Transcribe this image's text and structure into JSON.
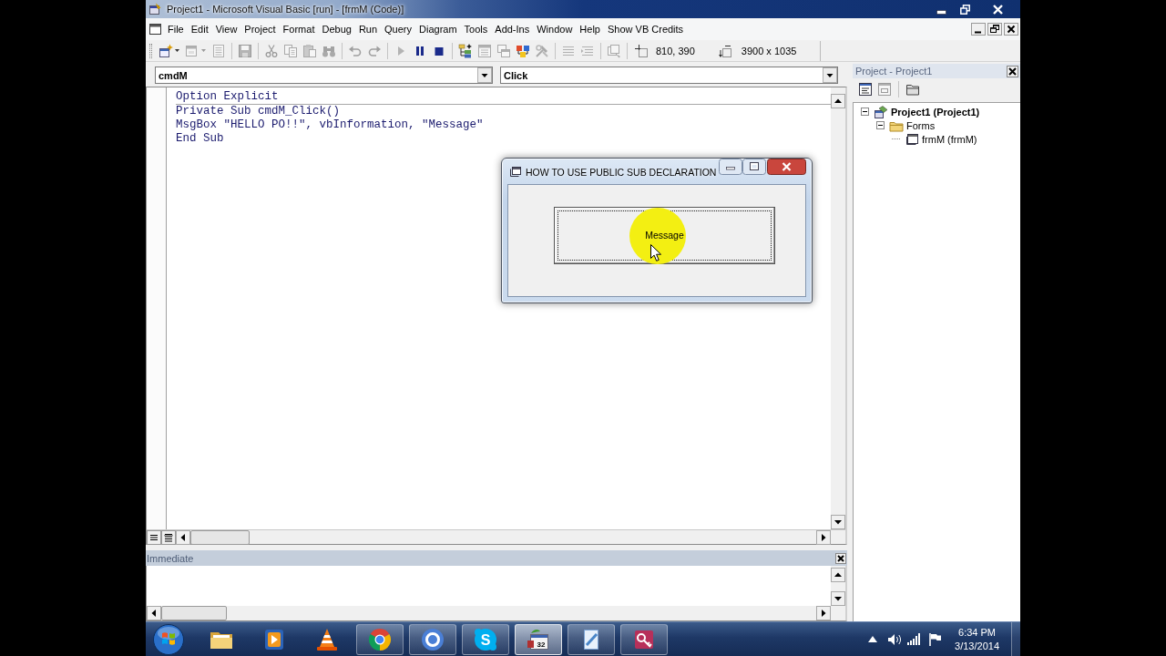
{
  "window": {
    "title": "Project1 - Microsoft Visual Basic [run] - [frmM (Code)]"
  },
  "menu_bar": {
    "items": [
      "File",
      "Edit",
      "View",
      "Project",
      "Format",
      "Debug",
      "Run",
      "Query",
      "Diagram",
      "Tools",
      "Add-Ins",
      "Window",
      "Help",
      "Show VB Credits"
    ]
  },
  "toolbar": {
    "groups": [
      [
        {
          "kind": "add-project",
          "disabled": false,
          "dropdown": true
        },
        {
          "kind": "add-form",
          "disabled": true,
          "dropdown": true
        },
        {
          "kind": "menu-editor",
          "disabled": true,
          "dropdown": false
        }
      ],
      [
        {
          "kind": "save",
          "disabled": true,
          "dropdown": false
        }
      ],
      [
        {
          "kind": "cut",
          "disabled": true,
          "dropdown": false
        },
        {
          "kind": "copy",
          "disabled": true,
          "dropdown": false
        },
        {
          "kind": "paste",
          "disabled": true,
          "dropdown": false
        },
        {
          "kind": "find",
          "disabled": true,
          "dropdown": false
        }
      ],
      [
        {
          "kind": "undo",
          "disabled": true,
          "dropdown": false
        },
        {
          "kind": "redo",
          "disabled": true,
          "dropdown": false
        }
      ],
      [
        {
          "kind": "start",
          "disabled": true,
          "dropdown": false
        },
        {
          "kind": "break",
          "disabled": false,
          "dropdown": false
        },
        {
          "kind": "end",
          "disabled": false,
          "dropdown": false
        }
      ],
      [
        {
          "kind": "project-explorer",
          "disabled": false,
          "dropdown": false
        },
        {
          "kind": "properties",
          "disabled": true,
          "dropdown": false
        },
        {
          "kind": "form-layout",
          "disabled": true,
          "dropdown": false
        },
        {
          "kind": "object-browser",
          "disabled": false,
          "dropdown": false
        },
        {
          "kind": "toolbox",
          "disabled": true,
          "dropdown": false
        }
      ],
      [
        {
          "kind": "comment",
          "disabled": true,
          "dropdown": false
        },
        {
          "kind": "uncomment",
          "disabled": true,
          "dropdown": false
        }
      ],
      [
        {
          "kind": "form-editor",
          "disabled": true,
          "dropdown": false
        }
      ]
    ],
    "position": "810, 390",
    "size": "3900 x 1035"
  },
  "code_window": {
    "object": "cmdM",
    "procedure": "Click",
    "sections": [
      {
        "lines": [
          "Option Explicit"
        ]
      },
      {
        "lines": [
          "Private Sub cmdM_Click()",
          "MsgBox \"HELLO PO!!\", vbInformation, \"Message\"",
          "End Sub"
        ]
      }
    ]
  },
  "immediate": {
    "title": "Immediate"
  },
  "project_explorer": {
    "title": "Project - Project1",
    "toolbar": [
      {
        "kind": "view-code",
        "disabled": false
      },
      {
        "kind": "view-object",
        "disabled": true
      },
      {
        "kind": "toggle-folders",
        "disabled": false
      }
    ],
    "tree": [
      {
        "kind": "project",
        "label": "Project1 (Project1)",
        "expanded": true,
        "children": [
          {
            "kind": "folder",
            "label": "Forms",
            "expanded": true,
            "children": [
              {
                "kind": "form",
                "label": "frmM (frmM)"
              }
            ]
          }
        ]
      }
    ]
  },
  "dialog": {
    "title": "HOW TO USE PUBLIC SUB DECLARATION",
    "button": "Message"
  },
  "taskbar": {
    "items": [
      {
        "kind": "folder",
        "running": false,
        "selected": false
      },
      {
        "kind": "media-player",
        "running": false,
        "selected": false
      },
      {
        "kind": "cone",
        "running": false,
        "selected": false
      },
      {
        "kind": "chrome",
        "running": true,
        "selected": false
      },
      {
        "kind": "ring",
        "running": true,
        "selected": false
      },
      {
        "kind": "skype",
        "label": "S",
        "running": true,
        "selected": false
      },
      {
        "kind": "vb",
        "label": "32",
        "running": true,
        "selected": true
      },
      {
        "kind": "notepad",
        "running": true,
        "selected": false
      },
      {
        "kind": "access",
        "running": true,
        "selected": false
      }
    ],
    "time": "6:34 PM",
    "date": "3/13/2014"
  }
}
